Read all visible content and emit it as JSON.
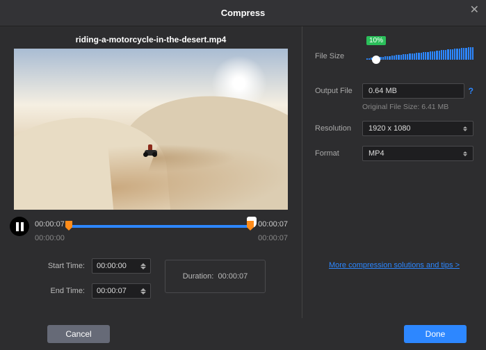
{
  "title": "Compress",
  "file_name": "riding-a-motorcycle-in-the-desert.mp4",
  "playback": {
    "current": "00:00:07",
    "end": "00:00:07",
    "range_start": "00:00:00",
    "range_end": "00:00:07"
  },
  "time_controls": {
    "start_label": "Start Time:",
    "start_value": "00:00:00",
    "end_label": "End Time:",
    "end_value": "00:00:07",
    "duration_label": "Duration:",
    "duration_value": "00:00:07"
  },
  "settings": {
    "file_size_label": "File Size",
    "file_size_percent": "10%",
    "output_label": "Output File",
    "output_value": "0.64  MB",
    "original_size_text": "Original File Size: 6.41 MB",
    "resolution_label": "Resolution",
    "resolution_value": "1920 x 1080",
    "format_label": "Format",
    "format_value": "MP4",
    "more_link": "More compression solutions and tips >"
  },
  "buttons": {
    "cancel": "Cancel",
    "done": "Done"
  }
}
